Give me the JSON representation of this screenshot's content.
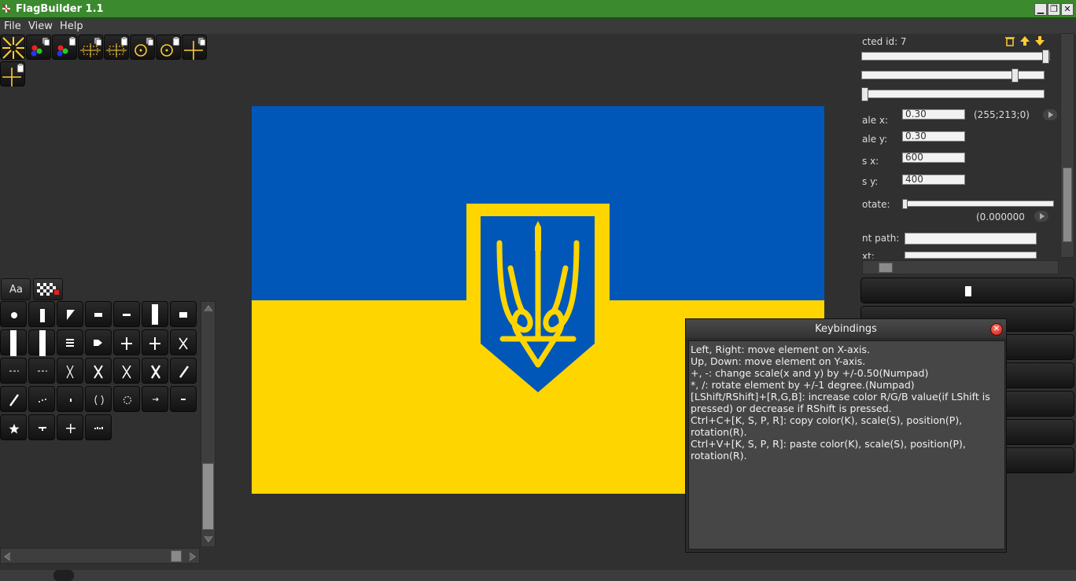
{
  "window": {
    "title": "FlagBuilder 1.1",
    "controls": [
      "▁",
      "❐",
      "✕"
    ]
  },
  "menu": {
    "items": [
      "File",
      "View",
      "Help"
    ]
  },
  "toolbar": {
    "icons": [
      "shrink-arrows-icon",
      "copy-color-icon",
      "paste-color-icon",
      "copy-scale-icon",
      "paste-scale-icon",
      "copy-rotation-icon",
      "paste-rotation-icon",
      "copy-position-icon",
      "paste-position-icon"
    ]
  },
  "tabs": {
    "text_tab": "Aa"
  },
  "flag": {
    "top_color": "#0057b7",
    "bottom_color": "#ffd500",
    "emblem": "trident-icon"
  },
  "properties": {
    "selected_label": "cted id: 7",
    "color_value": "(255;213;0)",
    "scale_x_label": "ale x:",
    "scale_x_value": "0.30",
    "scale_y_label": "ale y:",
    "scale_y_value": "0.30",
    "pos_x_label": "s x:",
    "pos_x_value": "600",
    "pos_y_label": "s y:",
    "pos_y_value": "400",
    "rotate_label": "otate:",
    "rotate_value": "(0.000000",
    "path_label": "nt path:",
    "text_label": "xt:",
    "sliders": {
      "r": 1.0,
      "g": 0.84,
      "b": 0.0
    }
  },
  "keybindings": {
    "title": "Keybindings",
    "lines": [
      "Left, Right: move element on X-axis.",
      "Up, Down: move element on Y-axis.",
      "+, -: change scale(x and y) by +/-0.50(Numpad)",
      "*, /: rotate element by +/-1 degree.(Numpad)",
      "[LShift/RShift]+[R,G,B]: increase color R/G/B value(if LShift is pressed) or decrease if RShift is pressed.",
      "Ctrl+C+[K, S, P, R]: copy color(K), scale(S), position(P), rotation(R).",
      "Ctrl+V+[K, S, P, R]: paste color(K), scale(S), position(P), rotation(R)."
    ]
  }
}
